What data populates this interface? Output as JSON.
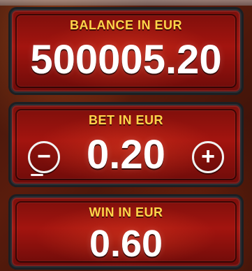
{
  "balance": {
    "label": "BALANCE IN EUR",
    "value": "500005.20"
  },
  "bet": {
    "label": "BET IN EUR",
    "value": "0.20",
    "minus_icon": "−",
    "plus_icon": "+"
  },
  "win": {
    "label": "WIN IN EUR",
    "value": "0.60"
  },
  "colors": {
    "title_yellow": "#ffd54a",
    "panel_red": "#a3140f",
    "frame_dark": "#1b1f23"
  },
  "icons": {
    "minus": "minus-icon",
    "plus": "plus-icon"
  }
}
